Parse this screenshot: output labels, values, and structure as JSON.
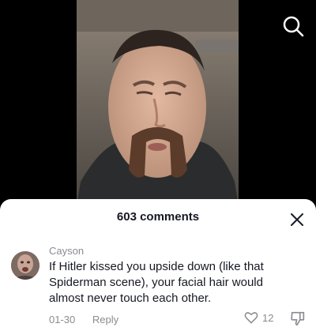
{
  "header": {
    "search_icon": "search-icon"
  },
  "sheet": {
    "comments_count": "603 comments",
    "close_icon": "close-icon"
  },
  "comment": {
    "username": "Cayson",
    "text": "If Hitler kissed you upside down (like that Spiderman scene), your facial hair would almost never touch each other.",
    "date": "01-30",
    "reply_label": "Reply",
    "like_count": "12",
    "like_icon": "heart-outline-icon",
    "dislike_icon": "thumb-down-icon"
  }
}
